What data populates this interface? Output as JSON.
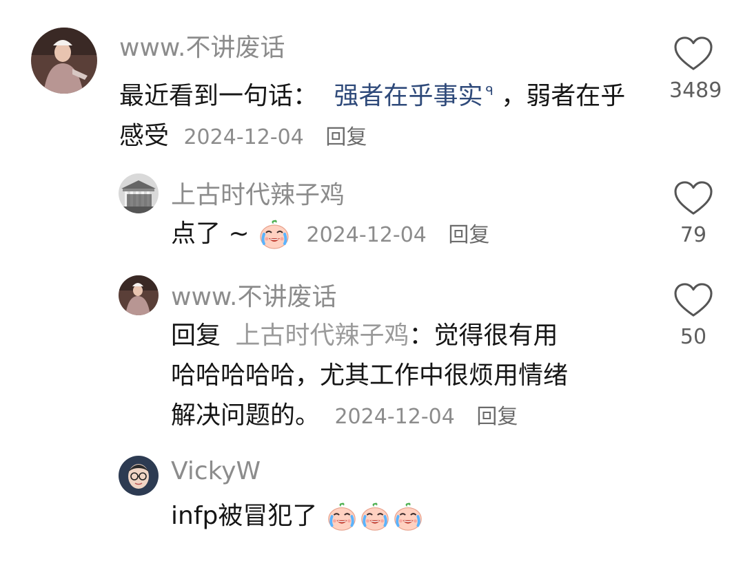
{
  "comments": [
    {
      "username": "www.不讲废话",
      "text_before": "最近看到一句话：",
      "highlight": "强者在乎事实",
      "text_after": "，弱者在乎感受",
      "date": "2024-12-04",
      "reply_label": "回复",
      "likes": "3489"
    }
  ],
  "replies": [
    {
      "username": "上古时代辣子鸡",
      "text": "点了 ~",
      "emoji": "crying-laughing-face-icon",
      "date": "2024-12-04",
      "reply_label": "回复",
      "likes": "79"
    },
    {
      "username": "www.不讲废话",
      "reply_prefix": "回复",
      "mention": "上古时代辣子鸡",
      "line1_text": "：觉得很有用",
      "line2_text": "哈哈哈哈哈，尤其工作中很烦用情绪",
      "line3_text": "解决问题的。",
      "date": "2024-12-04",
      "reply_label": "回复",
      "likes": "50"
    },
    {
      "username": "VickyW",
      "text": "infp被冒犯了",
      "emoji_count": 3,
      "emoji": "crying-laughing-face-icon"
    }
  ],
  "colors": {
    "username": "#8c8c8c",
    "highlight": "#2f4a7a",
    "body_text": "#161616",
    "meta": "#8c8c8c"
  }
}
